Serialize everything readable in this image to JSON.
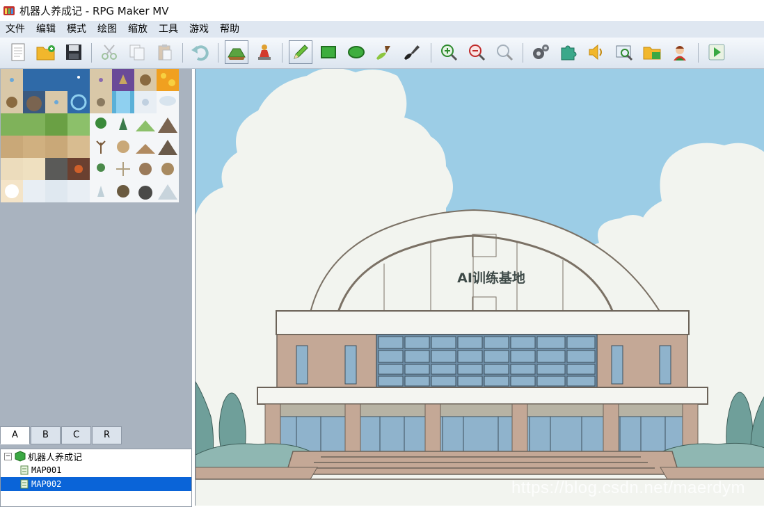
{
  "window": {
    "title": "机器人养成记 - RPG Maker MV"
  },
  "menu": [
    "文件",
    "编辑",
    "模式",
    "绘图",
    "缩放",
    "工具",
    "游戏",
    "帮助"
  ],
  "toolbar": {
    "items": [
      {
        "name": "new-project-icon"
      },
      {
        "name": "open-project-icon"
      },
      {
        "name": "save-project-icon"
      },
      {
        "name": "cut-icon"
      },
      {
        "name": "copy-icon"
      },
      {
        "name": "paste-icon"
      },
      {
        "name": "undo-icon"
      },
      {
        "name": "map-mode-icon",
        "active": true
      },
      {
        "name": "event-mode-icon"
      },
      {
        "name": "pencil-icon",
        "active": true
      },
      {
        "name": "rectangle-icon"
      },
      {
        "name": "ellipse-icon"
      },
      {
        "name": "flood-fill-icon"
      },
      {
        "name": "shadow-pen-icon"
      },
      {
        "name": "zoom-in-icon"
      },
      {
        "name": "zoom-out-icon"
      },
      {
        "name": "zoom-actual-icon"
      },
      {
        "name": "database-icon"
      },
      {
        "name": "plugin-manager-icon"
      },
      {
        "name": "sound-test-icon"
      },
      {
        "name": "event-searcher-icon"
      },
      {
        "name": "resource-manager-icon"
      },
      {
        "name": "character-generator-icon"
      },
      {
        "name": "playtest-icon"
      }
    ]
  },
  "palette": {
    "tabs": [
      "A",
      "B",
      "C",
      "R"
    ],
    "selected_tab": "A"
  },
  "map_tree": {
    "project": "机器人养成记",
    "maps": [
      {
        "name": "MAP001",
        "selected": false
      },
      {
        "name": "MAP002",
        "selected": true
      }
    ]
  },
  "map": {
    "building_sign": "AI训练基地"
  },
  "watermark": "https://blog.csdn.net/maerdym",
  "colors": {
    "sky": "#9ccde6",
    "cloud": "#f2f4ef",
    "wall": "#c4a896",
    "glass": "#8fb3cc",
    "tree": "#6f9f9a",
    "selection": "#0a64d8"
  }
}
